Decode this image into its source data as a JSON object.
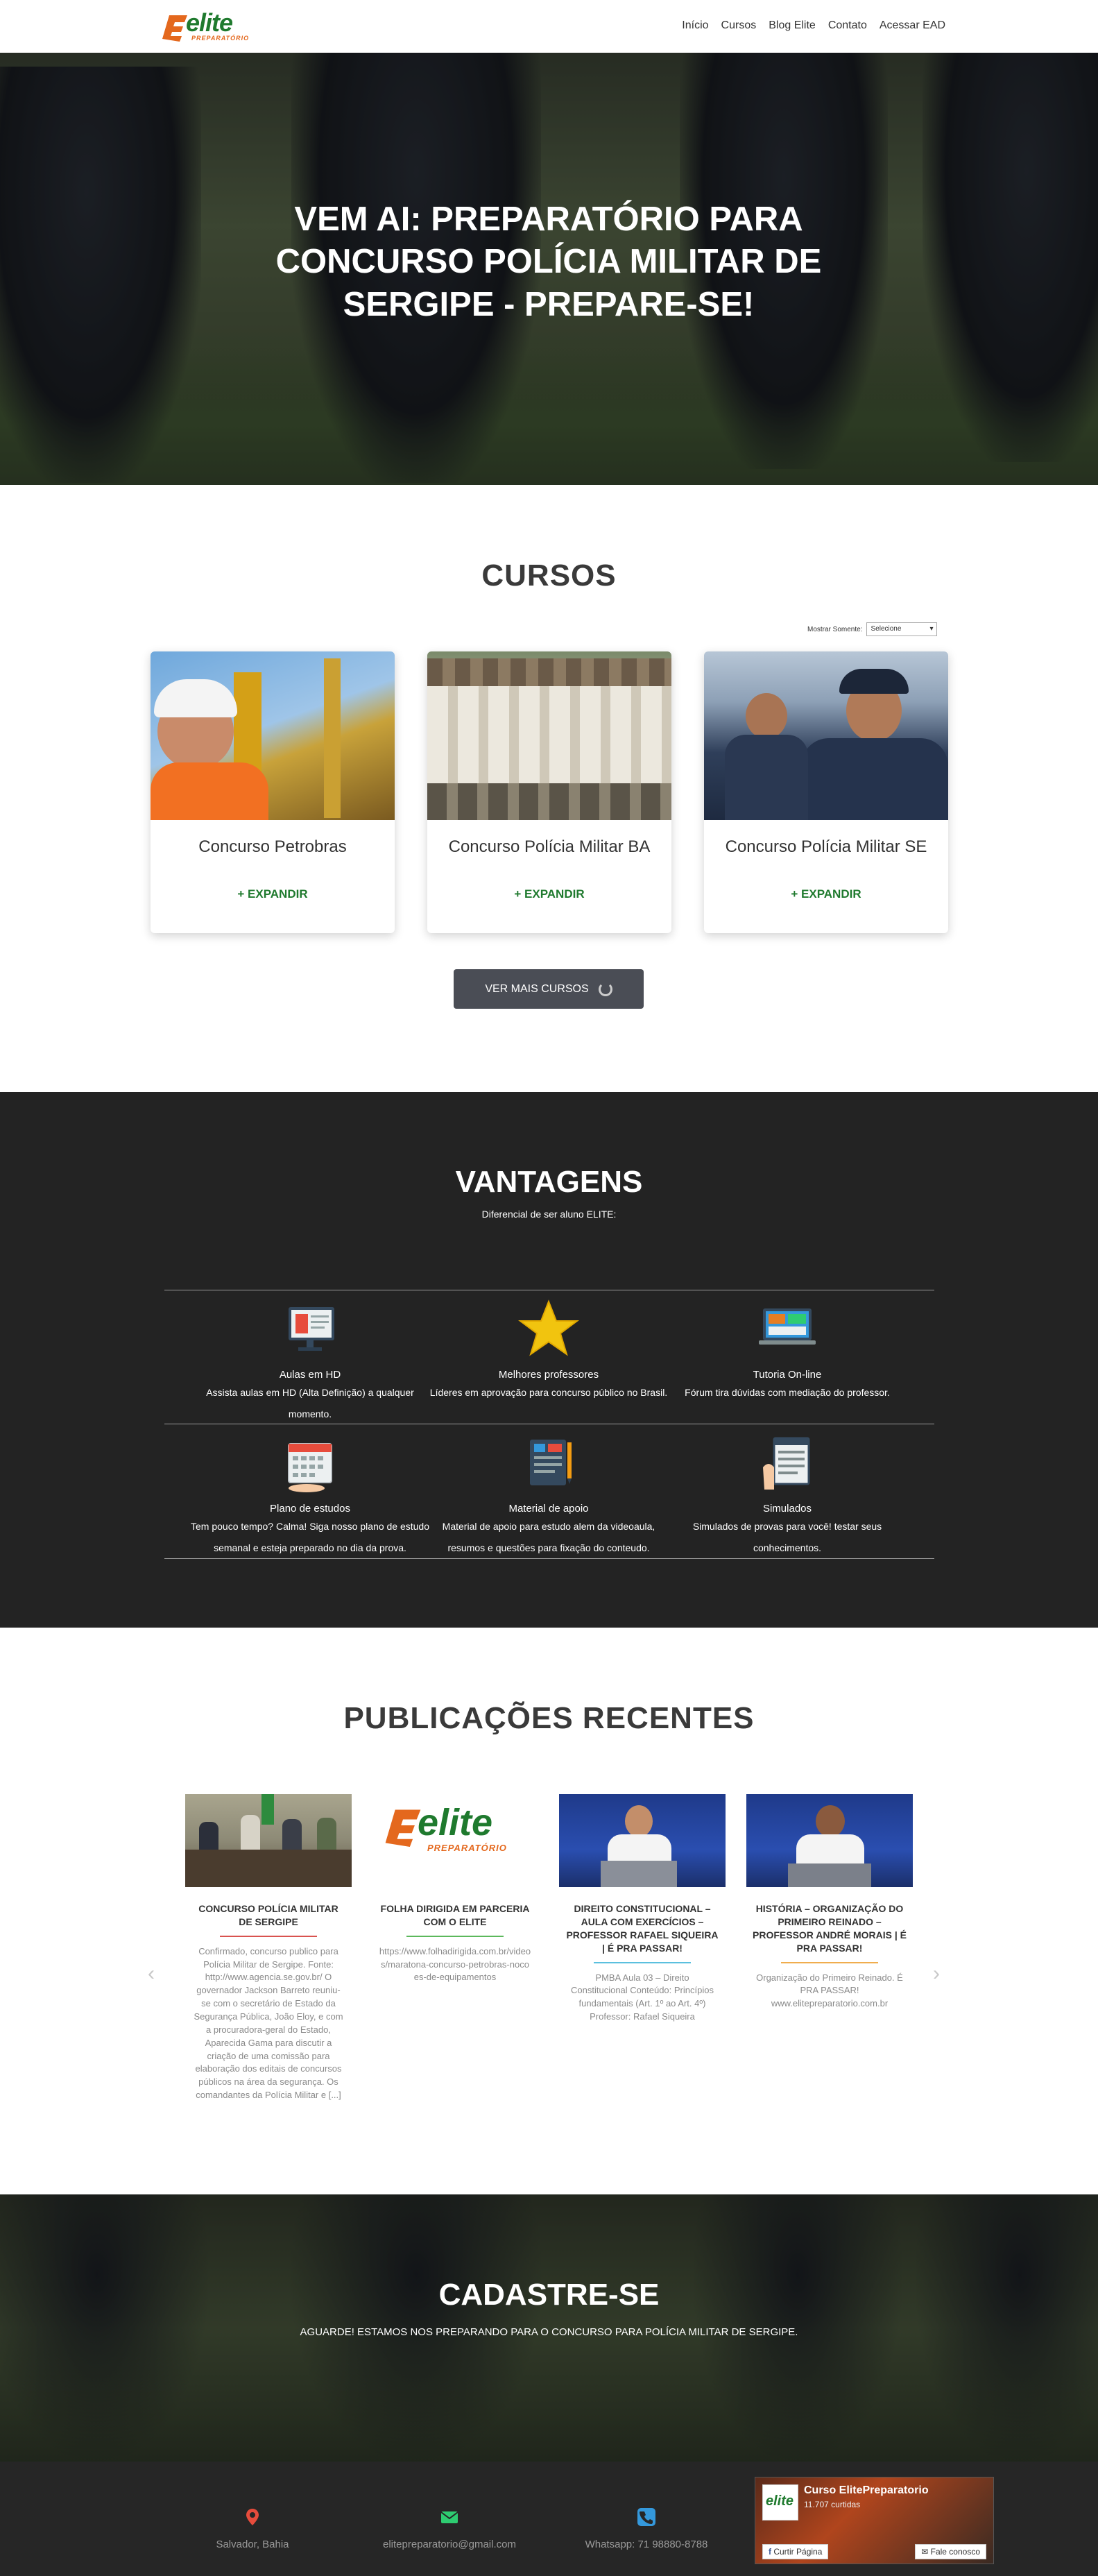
{
  "nav": {
    "logo_brand": "elite",
    "logo_sub": "PREPARATÓRIO",
    "links": [
      "Início",
      "Cursos",
      "Blog Elite",
      "Contato",
      "Acessar EAD"
    ]
  },
  "hero": {
    "title": "VEM AI: PREPARATÓRIO PARA CONCURSO POLÍCIA MILITAR DE SERGIPE - PREPARE-SE!"
  },
  "cursos": {
    "title": "CURSOS",
    "filter_label": "Mostrar Somente:",
    "filter_value": "Selecione",
    "cards": [
      {
        "title": "Concurso Petrobras",
        "action": "+ EXPANDIR"
      },
      {
        "title": "Concurso Polícia Militar BA",
        "action": "+ EXPANDIR"
      },
      {
        "title": "Concurso Polícia Militar SE",
        "action": "+ EXPANDIR"
      }
    ],
    "more_label": "VER MAIS CURSOS"
  },
  "vantagens": {
    "title": "VANTAGENS",
    "subtitle": "Diferencial de ser aluno ELITE:",
    "items": [
      {
        "title": "Aulas em HD",
        "desc": "Assista aulas em HD (Alta Definição) a qualquer momento.",
        "icon": "video-lesson-icon"
      },
      {
        "title": "Melhores professores",
        "desc": "Líderes em aprovação para concurso público no Brasil.",
        "icon": "star-icon"
      },
      {
        "title": "Tutoria On-line",
        "desc": "Fórum tira dúvidas com mediação do professor.",
        "icon": "online-tutoring-icon"
      },
      {
        "title": "Plano de estudos",
        "desc": "Tem pouco tempo? Calma! Siga nosso plano de estudo semanal e esteja preparado no dia da prova.",
        "icon": "calendar-icon"
      },
      {
        "title": "Material de apoio",
        "desc": "Material de apoio para estudo alem da videoaula, resumos e questões para fixação do conteudo.",
        "icon": "study-material-icon"
      },
      {
        "title": "Simulados",
        "desc": "Simulados de provas para você! testar seus conhecimentos.",
        "icon": "exam-icon"
      }
    ]
  },
  "publicacoes": {
    "title": "PUBLICAÇÕES RECENTES",
    "posts": [
      {
        "title": "CONCURSO POLÍCIA MILITAR DE SERGIPE",
        "desc": "Confirmado, concurso publico para Polícia Militar de Sergipe. Fonte: http://www.agencia.se.gov.br/ O governador Jackson Barreto reuniu-se com o secretário de Estado da Segurança Pública, João Eloy, e com a procuradora-geral do Estado, Aparecida Gama para discutir a criação de uma comissão para elaboração dos editais de concursos públicos na área da segurança. Os comandantes da Polícia Militar e [...]",
        "bar_color": "#d9534f"
      },
      {
        "title": "FOLHA DIRIGIDA EM PARCERIA COM O ELITE",
        "desc": "https://www.folhadirigida.com.br/videos/maratona-concurso-petrobras-nocoes-de-equipamentos",
        "bar_color": "#5cb85c"
      },
      {
        "title": "DIREITO CONSTITUCIONAL – AULA COM EXERCÍCIOS – PROFESSOR RAFAEL SIQUEIRA | É PRA PASSAR!",
        "desc": "PMBA Aula 03 – Direito Constitucional Conteúdo: Princípios fundamentais (Art. 1º ao Art. 4º) Professor: Rafael Siqueira",
        "bar_color": "#5bc0de"
      },
      {
        "title": "HISTÓRIA – ORGANIZAÇÃO DO PRIMEIRO REINADO – PROFESSOR ANDRÉ MORAIS | É PRA PASSAR!",
        "desc": "Organização do Primeiro Reinado. É PRA PASSAR! www.elitepreparatorio.com.br",
        "bar_color": "#f0ad4e"
      }
    ]
  },
  "cadastre": {
    "title": "CADASTRE-SE",
    "text": "AGUARDE! ESTAMOS NOS PREPARANDO PARA O CONCURSO PARA POLÍCIA MILITAR DE SERGIPE."
  },
  "footer": {
    "location": "Salvador, Bahia",
    "email": "elitepreparatorio@gmail.com",
    "phone": "Whatsapp: 71 98880-8788",
    "fb_page": "Curso ElitePreparatorio",
    "fb_likes": "11.707 curtidas",
    "fb_like_btn": "Curtir Página",
    "fb_contact_btn": "Fale conosco"
  },
  "colors": {
    "brand_green": "#1f7a2e",
    "brand_orange": "#e4681d",
    "dark_bg": "#232323"
  }
}
